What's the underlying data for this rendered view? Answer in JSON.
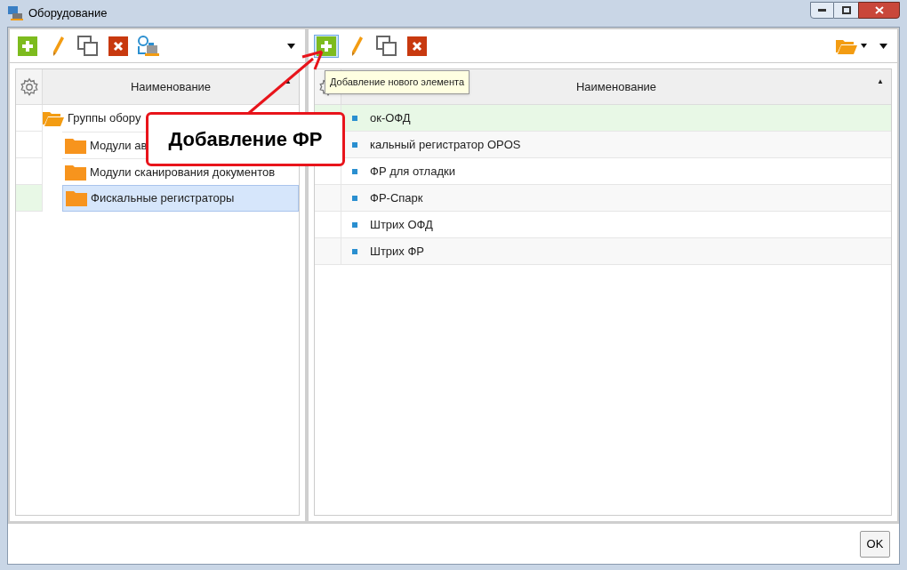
{
  "window": {
    "title": "Оборудование"
  },
  "left_panel": {
    "toolbar": [
      {
        "kind": "add",
        "hovered": false
      },
      {
        "kind": "edit",
        "hovered": false
      },
      {
        "kind": "copy",
        "hovered": false
      },
      {
        "kind": "delete",
        "hovered": false
      },
      {
        "kind": "equipment",
        "hovered": false
      },
      {
        "kind": "menu",
        "hovered": false
      }
    ],
    "column": "Наименование",
    "sort": "▲",
    "tree": [
      {
        "label": "Группы обору",
        "selected": false,
        "children": [
          {
            "label": "Модули ав",
            "selected": false
          },
          {
            "label": "Модули сканирования документов",
            "selected": false
          },
          {
            "label": "Фискальные регистраторы",
            "selected": true
          }
        ]
      }
    ]
  },
  "right_panel": {
    "toolbar": [
      {
        "kind": "add",
        "hovered": true
      },
      {
        "kind": "edit",
        "hovered": false
      },
      {
        "kind": "copy",
        "hovered": false
      },
      {
        "kind": "delete",
        "hovered": false
      },
      {
        "kind": "folder-menu",
        "hovered": false
      },
      {
        "kind": "menu",
        "hovered": false
      }
    ],
    "tooltip": "Добавление нового элемента",
    "column": "Наименование",
    "sort": "▲",
    "rows": [
      {
        "label": "ок-ОФД",
        "selected": true
      },
      {
        "label": "кальный регистратор OPOS",
        "selected": false
      },
      {
        "label": "ФР для отладки",
        "selected": false
      },
      {
        "label": "ФР-Спарк",
        "selected": false
      },
      {
        "label": "Штрих ОФД",
        "selected": false
      },
      {
        "label": "Штрих ФР",
        "selected": false
      }
    ]
  },
  "callout": "Добавление ФР",
  "buttons": [
    "OK"
  ]
}
